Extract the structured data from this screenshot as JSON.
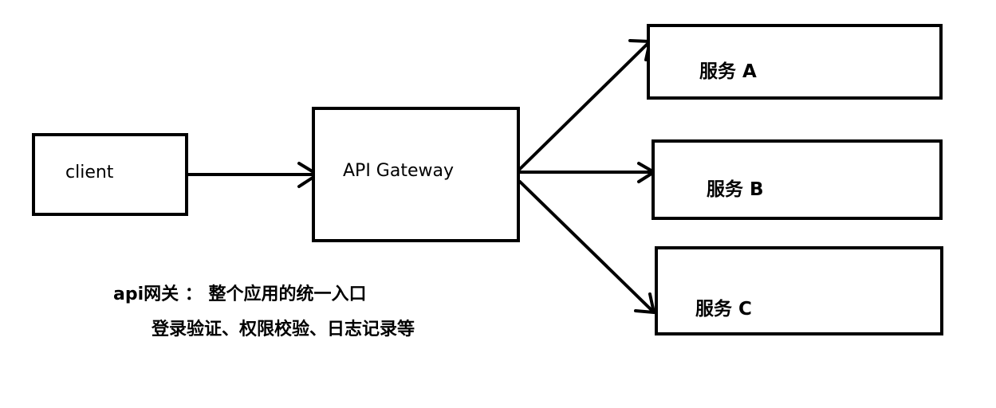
{
  "client": {
    "label": "client"
  },
  "gateway": {
    "label": "API Gateway"
  },
  "services": [
    {
      "label": "服务 A"
    },
    {
      "label": "服务 B"
    },
    {
      "label": "服务 C"
    }
  ],
  "note": {
    "line1": "api网关 ： 整个应用的统一入口",
    "line2": "登录验证、权限校验、日志记录等"
  },
  "colors": {
    "stroke": "#000000",
    "background": "#ffffff"
  }
}
